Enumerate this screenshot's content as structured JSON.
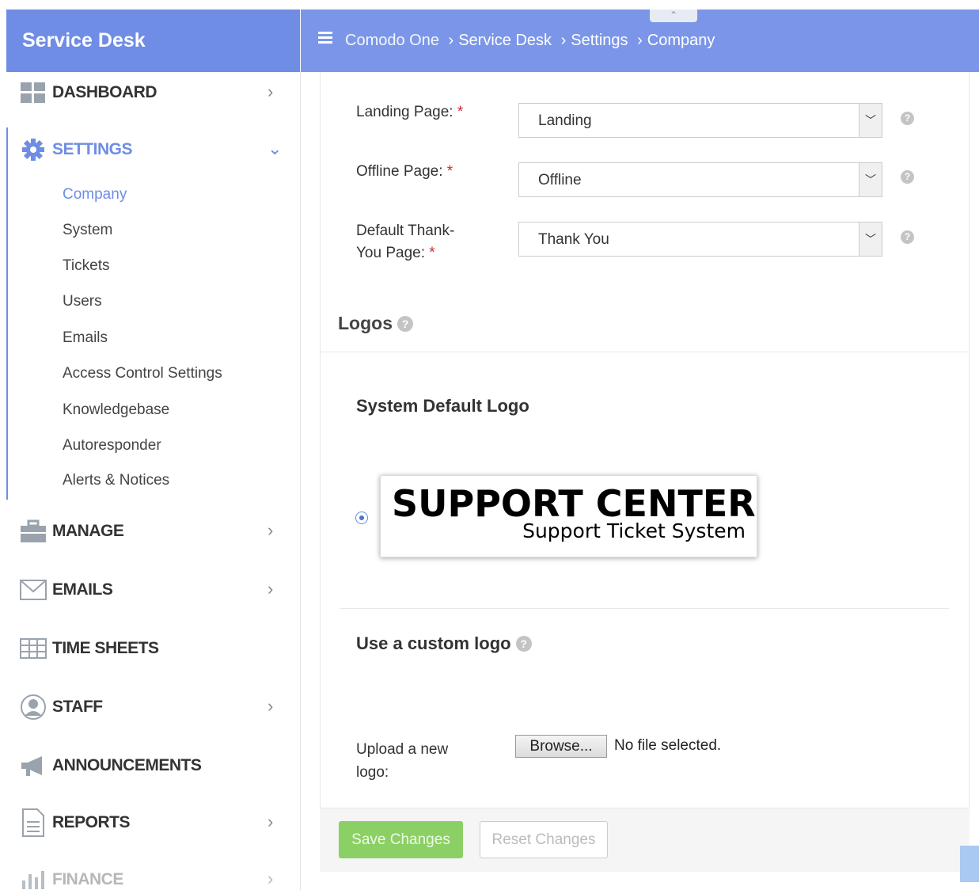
{
  "app": {
    "title": "Service Desk"
  },
  "breadcrumb": [
    "Comodo One",
    "Service Desk",
    "Settings",
    "Company"
  ],
  "sidebar": {
    "dashboard": "DASHBOARD",
    "settings": "SETTINGS",
    "settings_items": [
      "Company",
      "System",
      "Tickets",
      "Users",
      "Emails",
      "Access Control Settings",
      "Knowledgebase",
      "Autoresponder",
      "Alerts & Notices"
    ],
    "manage": "MANAGE",
    "emails": "EMAILS",
    "time_sheets": "TIME SHEETS",
    "staff": "STAFF",
    "announcements": "ANNOUNCEMENTS",
    "reports": "REPORTS",
    "finance": "FINANCE"
  },
  "form": {
    "landing_label": "Landing Page:",
    "landing_value": "Landing",
    "offline_label": "Offline Page:",
    "offline_value": "Offline",
    "thankyou_label_1": "Default Thank-",
    "thankyou_label_2": "You Page:",
    "thankyou_value": "Thank You",
    "required_mark": "*"
  },
  "logos": {
    "title": "Logos",
    "system_default": "System Default Logo",
    "logo_main": "SUPPORT CENTER",
    "logo_sub": "Support Ticket System",
    "custom": "Use a custom logo",
    "upload_label_1": "Upload a new",
    "upload_label_2": "logo:",
    "browse": "Browse...",
    "no_file": "No file selected."
  },
  "actions": {
    "save": "Save Changes",
    "reset": "Reset Changes"
  },
  "colors": {
    "header": "#7b96e8",
    "brand": "#6f8de4",
    "active": "#6f8de4",
    "save": "#8bd064",
    "required": "#d9242a"
  }
}
